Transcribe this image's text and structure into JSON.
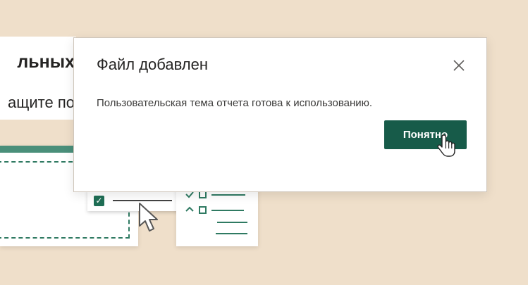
{
  "background": {
    "heading_fragment": "льных",
    "subtitle_fragment": "ащите по",
    "icons": [
      "checkbox-icon",
      "pointer-cursor-icon",
      "checklist-icon"
    ]
  },
  "dialog": {
    "title": "Файл добавлен",
    "message": "Пользовательская тема отчета готова к использованию.",
    "confirm_label": "Понятно",
    "close_icon": "close-icon",
    "cursor_icon": "hand-pointer-icon"
  },
  "colors": {
    "page_background": "#efdfca",
    "accent_green": "#175b49",
    "dialog_background": "#ffffff"
  }
}
